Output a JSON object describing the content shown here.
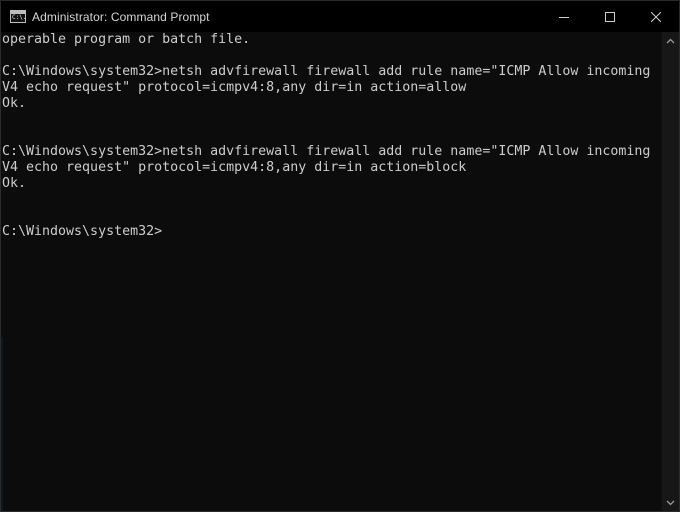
{
  "window": {
    "title": "Administrator: Command Prompt",
    "icon": "cmd-icon",
    "icon_glyph": "C:\\."
  },
  "controls": {
    "minimize": "minimize-icon",
    "maximize": "maximize-icon",
    "close": "close-icon"
  },
  "console": {
    "lines": [
      "operable program or batch file.",
      "",
      "C:\\Windows\\system32>netsh advfirewall firewall add rule name=\"ICMP Allow incoming",
      "V4 echo request\" protocol=icmpv4:8,any dir=in action=allow",
      "Ok.",
      "",
      "",
      "C:\\Windows\\system32>netsh advfirewall firewall add rule name=\"ICMP Allow incoming",
      "V4 echo request\" protocol=icmpv4:8,any dir=in action=block",
      "Ok.",
      "",
      "",
      "C:\\Windows\\system32>"
    ]
  },
  "colors": {
    "background": "#0c0c0c",
    "foreground": "#cccccc",
    "titlebar": "#000000"
  }
}
